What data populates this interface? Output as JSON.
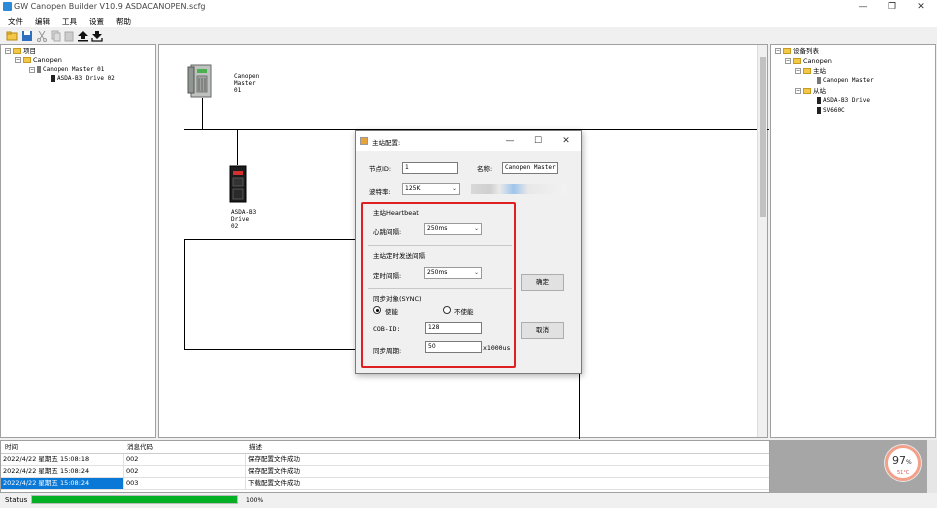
{
  "window": {
    "title": "GW Canopen Builder V10.9   ASDACANOPEN.scfg",
    "minimize": "—",
    "maximize": "❐",
    "close": "✕"
  },
  "menu": [
    "文件",
    "编辑",
    "工具",
    "设置",
    "帮助"
  ],
  "toolbar": [
    "open-icon",
    "save-icon",
    "cut-icon",
    "copy-icon",
    "paste-icon",
    "upload-icon",
    "download-icon"
  ],
  "project_tree": {
    "root": "项目",
    "canopen": "Canopen",
    "master": "Canopen Master  01",
    "drive": "ASDA-B3 Drive 02"
  },
  "canvas": {
    "master_label": [
      "Canopen",
      "Master",
      "01"
    ],
    "drive_label": [
      "ASDA-B3",
      "Drive",
      "02"
    ]
  },
  "device_list": {
    "root": "设备列表",
    "canopen": "Canopen",
    "master_group": "主站",
    "master": "Canopen Master",
    "slave_group": "从站",
    "slave1": "ASDA-B3 Drive",
    "slave2": "SV660C"
  },
  "dialog": {
    "title": "主站配置:",
    "node_id_label": "节点ID:",
    "node_id_value": "1",
    "name_label": "名称:",
    "name_value": "Canopen Master",
    "baud_label": "波特率:",
    "baud_value": "125K",
    "heartbeat_section": "主站Heartbeat",
    "heartbeat_label": "心跳间隔:",
    "heartbeat_value": "250ms",
    "timer_section": "主站定时发送间隔",
    "timer_label": "定时间隔:",
    "timer_value": "250ms",
    "sync_section": "同步对象(SYNC)",
    "sync_enable": "使能",
    "sync_disable": "不使能",
    "cob_label": "COB-ID:",
    "cob_value": "128",
    "period_label": "同步周期:",
    "period_value": "50",
    "period_unit": "x1000us",
    "ok": "确定",
    "cancel": "取消",
    "highlight_color": "#e02020"
  },
  "log": {
    "headers": [
      "时间",
      "消息代码",
      "描述"
    ],
    "rows": [
      [
        "2022/4/22 星期五 15:08:18",
        "002",
        "保存配置文件成功"
      ],
      [
        "2022/4/22 星期五 15:08:24",
        "002",
        "保存配置文件成功"
      ],
      [
        "2022/4/22 星期五 15:08:24",
        "003",
        "下载配置文件成功"
      ]
    ],
    "selected_row": 2
  },
  "status": {
    "label": "Status",
    "progress": 1.0,
    "percent": "100%"
  },
  "widget": {
    "value": "97",
    "unit": "%",
    "temp": "51°C"
  }
}
